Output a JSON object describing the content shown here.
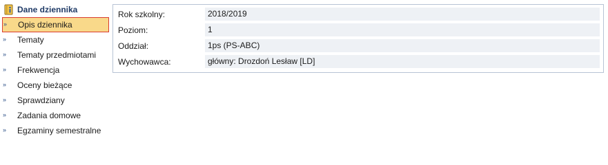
{
  "sidebar": {
    "header_title": "Dane dziennika",
    "header_icon": "info-book-icon",
    "items": [
      {
        "label": "Opis dziennika",
        "selected": true
      },
      {
        "label": "Tematy"
      },
      {
        "label": "Tematy przedmiotami"
      },
      {
        "label": "Frekwencja"
      },
      {
        "label": "Oceny bieżące"
      },
      {
        "label": "Sprawdziany"
      },
      {
        "label": "Zadania domowe"
      },
      {
        "label": "Egzaminy semestralne"
      }
    ],
    "chevron_glyph": "»"
  },
  "details": {
    "rows": [
      {
        "label": "Rok szkolny:",
        "value": "2018/2019"
      },
      {
        "label": "Poziom:",
        "value": "1"
      },
      {
        "label": "Oddział:",
        "value": "1ps (PS-ABC)"
      },
      {
        "label": "Wychowawca:",
        "value": "główny: Drozdoń Lesław [LD]"
      }
    ]
  },
  "colors": {
    "selected_bg": "#f9d98a",
    "selected_border": "#d93b2e",
    "panel_border": "#b7c3d4",
    "value_bg": "#eef1f5",
    "header_text": "#1f3a66"
  }
}
